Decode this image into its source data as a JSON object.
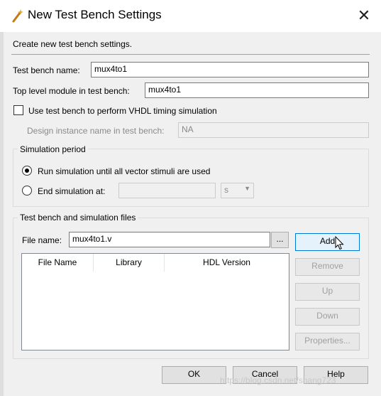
{
  "window": {
    "title": "New Test Bench Settings",
    "title_icon": "wand-icon",
    "close_glyph": "✕"
  },
  "subtitle": "Create new test bench settings.",
  "fields": {
    "test_bench_name_label": "Test bench name:",
    "test_bench_name_value": "mux4to1",
    "top_level_label": "Top level module in test bench:",
    "top_level_value": "mux4to1",
    "vhdl_timing_label": "Use test bench to perform VHDL timing simulation",
    "design_instance_label": "Design instance name in test bench:",
    "design_instance_value": "NA"
  },
  "simulation_period": {
    "title": "Simulation period",
    "run_until_label": "Run simulation until all vector stimuli are used",
    "end_at_label": "End simulation at:",
    "end_at_value": "",
    "unit": "s"
  },
  "files": {
    "title": "Test bench and simulation files",
    "file_name_label": "File name:",
    "file_name_value": "mux4to1.v",
    "browse_label": "...",
    "columns": [
      "File Name",
      "Library",
      "HDL Version"
    ],
    "buttons": {
      "add": "Add",
      "remove": "Remove",
      "up": "Up",
      "down": "Down",
      "properties": "Properties..."
    }
  },
  "footer": {
    "ok": "OK",
    "cancel": "Cancel",
    "help": "Help"
  },
  "watermark": "https://blog.csdn.net/shang723"
}
